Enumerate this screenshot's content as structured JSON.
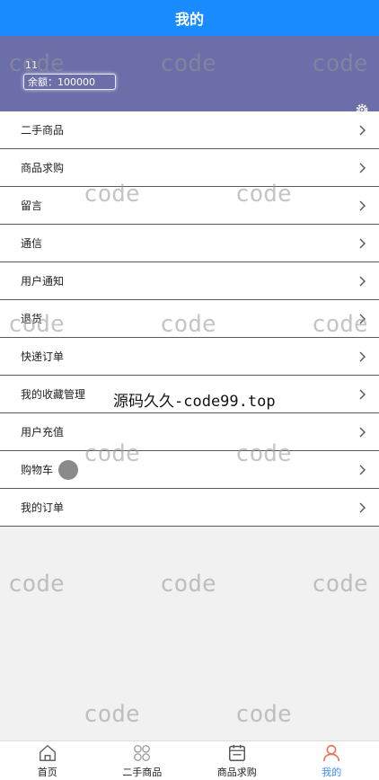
{
  "header": {
    "title": "我的"
  },
  "profile": {
    "username": "11",
    "balance_text": "余额：100000"
  },
  "menu": {
    "items": [
      {
        "label": "二手商品"
      },
      {
        "label": "商品求购"
      },
      {
        "label": "留言"
      },
      {
        "label": "通信"
      },
      {
        "label": "用户通知"
      },
      {
        "label": "退货"
      },
      {
        "label": "快递订单"
      },
      {
        "label": "我的收藏管理"
      },
      {
        "label": "用户充值"
      },
      {
        "label": "购物车"
      },
      {
        "label": "我的订单"
      }
    ]
  },
  "overlay": {
    "text": "源码久久-code99.top"
  },
  "watermark": {
    "text": "code"
  },
  "tabbar": {
    "tabs": [
      {
        "label": "首页",
        "icon": "home-icon"
      },
      {
        "label": "二手商品",
        "icon": "grid-icon"
      },
      {
        "label": "商品求购",
        "icon": "calendar-icon"
      },
      {
        "label": "我的",
        "icon": "user-icon",
        "active": true
      }
    ]
  },
  "colors": {
    "header": "#1a8cff",
    "profile": "#6b6ea9",
    "active_tab": "#3a8cff",
    "active_tab_icon": "#e8745a"
  }
}
